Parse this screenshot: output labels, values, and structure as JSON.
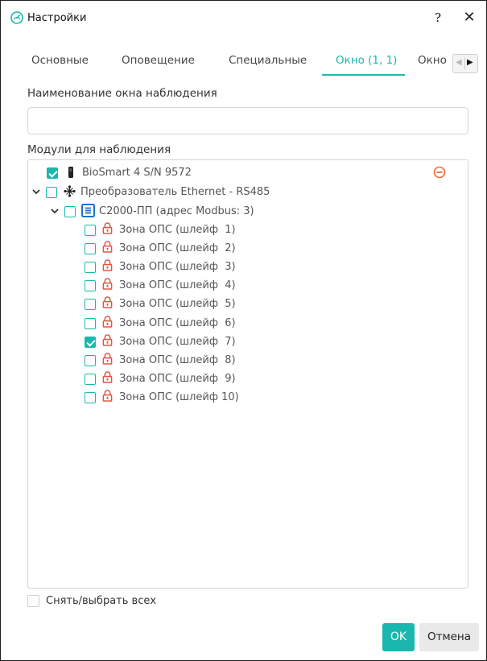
{
  "window": {
    "title": "Настройки",
    "help_label": "?",
    "close_label": "✕"
  },
  "tabs": [
    {
      "label": "Основные"
    },
    {
      "label": "Оповещение"
    },
    {
      "label": "Специальные"
    },
    {
      "label": "Окно (1, 1)",
      "active": true
    },
    {
      "label": "Окно"
    }
  ],
  "form": {
    "name_label": "Наименование окна наблюдения",
    "name_value": "",
    "modules_label": "Модули для наблюдения"
  },
  "tree": {
    "root_device": {
      "label": "BioSmart 4 S/N 9572",
      "checked": true
    },
    "converter": {
      "label": "Преобразователь Ethernet - RS485",
      "checked": false,
      "expanded": true
    },
    "controller": {
      "label": "С2000-ПП (адрес Modbus: 3)",
      "checked": false,
      "expanded": true
    },
    "zones": [
      {
        "label": "Зона ОПС (шлейф  1)",
        "checked": false
      },
      {
        "label": "Зона ОПС (шлейф  2)",
        "checked": false
      },
      {
        "label": "Зона ОПС (шлейф  3)",
        "checked": false
      },
      {
        "label": "Зона ОПС (шлейф  4)",
        "checked": false
      },
      {
        "label": "Зона ОПС (шлейф  5)",
        "checked": false
      },
      {
        "label": "Зона ОПС (шлейф  6)",
        "checked": false
      },
      {
        "label": "Зона ОПС (шлейф  7)",
        "checked": true
      },
      {
        "label": "Зона ОПС (шлейф  8)",
        "checked": false
      },
      {
        "label": "Зона ОПС (шлейф  9)",
        "checked": false
      },
      {
        "label": "Зона ОПС (шлейф 10)",
        "checked": false
      }
    ]
  },
  "footer": {
    "select_all_label": "Снять/выбрать всех",
    "ok_label": "OK",
    "cancel_label": "Отмена"
  },
  "colors": {
    "accent": "#19b7ad",
    "lock": "#e8533c",
    "remove": "#f06a3a"
  }
}
